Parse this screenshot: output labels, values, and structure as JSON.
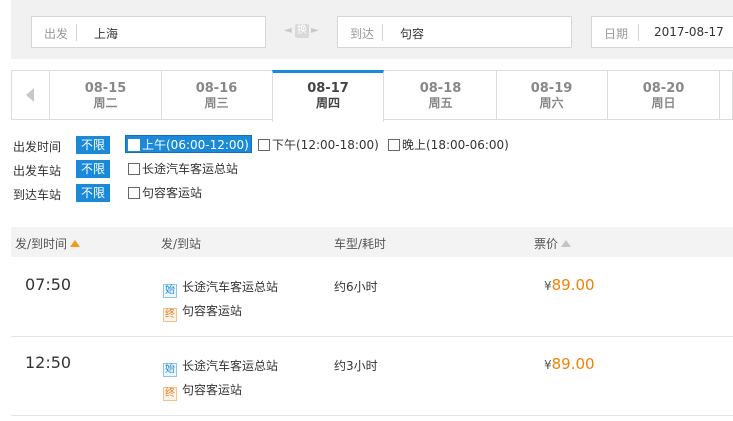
{
  "search": {
    "from_label": "出发",
    "from_value": "上海",
    "swap_label": "换",
    "to_label": "到达",
    "to_value": "句容",
    "date_label": "日期",
    "date_value": "2017-08-17"
  },
  "date_tabs": [
    {
      "date": "08-15",
      "weekday": "周二"
    },
    {
      "date": "08-16",
      "weekday": "周三"
    },
    {
      "date": "08-17",
      "weekday": "周四"
    },
    {
      "date": "08-18",
      "weekday": "周五"
    },
    {
      "date": "08-19",
      "weekday": "周六"
    },
    {
      "date": "08-20",
      "weekday": "周日"
    }
  ],
  "active_tab": 2,
  "filters": {
    "depart_time": {
      "label": "出发时间",
      "all": "不限",
      "options": [
        "上午(06:00-12:00)",
        "下午(12:00-18:00)",
        "晚上(18:00-06:00)"
      ]
    },
    "depart_station": {
      "label": "出发车站",
      "all": "不限",
      "options": [
        "长途汽车客运总站"
      ]
    },
    "arrive_station": {
      "label": "到达车站",
      "all": "不限",
      "options": [
        "句容客运站"
      ]
    }
  },
  "table": {
    "headers": {
      "time": "发/到时间",
      "stations": "发/到站",
      "type": "车型/耗时",
      "price": "票价"
    },
    "start_badge": "始",
    "end_badge": "终",
    "currency": "¥",
    "rows": [
      {
        "time": "07:50",
        "from": "长途汽车客运总站",
        "to": "句容客运站",
        "duration": "约6小时",
        "price": "89.00"
      },
      {
        "time": "12:50",
        "from": "长途汽车客运总站",
        "to": "句容客运站",
        "duration": "约3小时",
        "price": "89.00"
      }
    ]
  },
  "colors": {
    "accent": "#1a8ad8",
    "price": "#f08200",
    "sort_asc": "#f39a1e"
  }
}
